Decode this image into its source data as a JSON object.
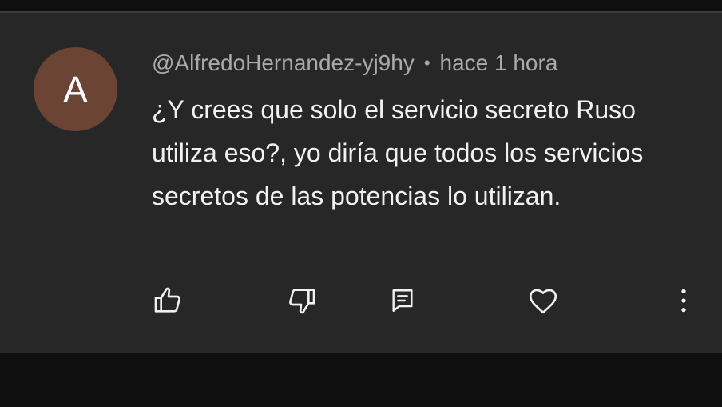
{
  "comment": {
    "avatar_letter": "A",
    "avatar_color": "#6b4436",
    "author": "@AlfredoHernandez-yj9hy",
    "separator": "•",
    "timestamp": "hace 1 hora",
    "text": "¿Y crees que solo el servicio secreto Ruso utiliza eso?, yo diría que todos los servicios secretos de las potencias lo utilizan."
  },
  "actions": {
    "icons": [
      "thumbs-up-icon",
      "thumbs-down-icon",
      "reply-icon",
      "heart-icon",
      "more-vertical-icon"
    ]
  },
  "theme": {
    "background": "#272727",
    "text": "#f1f1f1",
    "muted": "#aaaaaa"
  }
}
